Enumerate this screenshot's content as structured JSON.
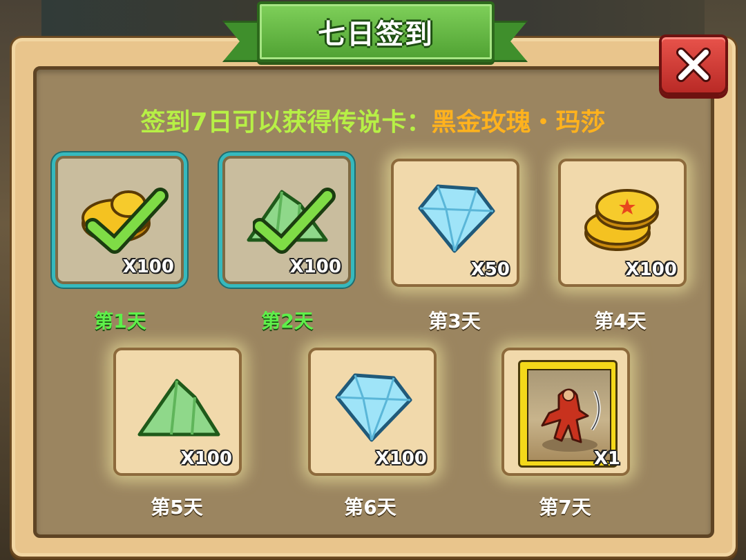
{
  "title": "七日签到",
  "subtitle": {
    "prefix": "签到7日可以获得传说卡：",
    "card_name": "黑金玫瑰・玛莎"
  },
  "colors": {
    "ribbon": "#4fa132",
    "claimed_day": "#5ef04a",
    "subtitle_green": "#b7f046",
    "subtitle_orange": "#ffb21e",
    "claimed_border": "#36b9bd"
  },
  "rewards": [
    {
      "day_label": "第1天",
      "item": "gold-coin-icon",
      "quantity": "X100",
      "claimed": true
    },
    {
      "day_label": "第2天",
      "item": "green-crystal-icon",
      "quantity": "X100",
      "claimed": true
    },
    {
      "day_label": "第3天",
      "item": "diamond-icon",
      "quantity": "X50",
      "claimed": false
    },
    {
      "day_label": "第4天",
      "item": "gold-coin-icon",
      "quantity": "X100",
      "claimed": false
    },
    {
      "day_label": "第5天",
      "item": "green-crystal-icon",
      "quantity": "X100",
      "claimed": false
    },
    {
      "day_label": "第6天",
      "item": "diamond-icon",
      "quantity": "X100",
      "claimed": false
    },
    {
      "day_label": "第7天",
      "item": "legend-card-icon",
      "quantity": "X1",
      "claimed": false
    }
  ]
}
